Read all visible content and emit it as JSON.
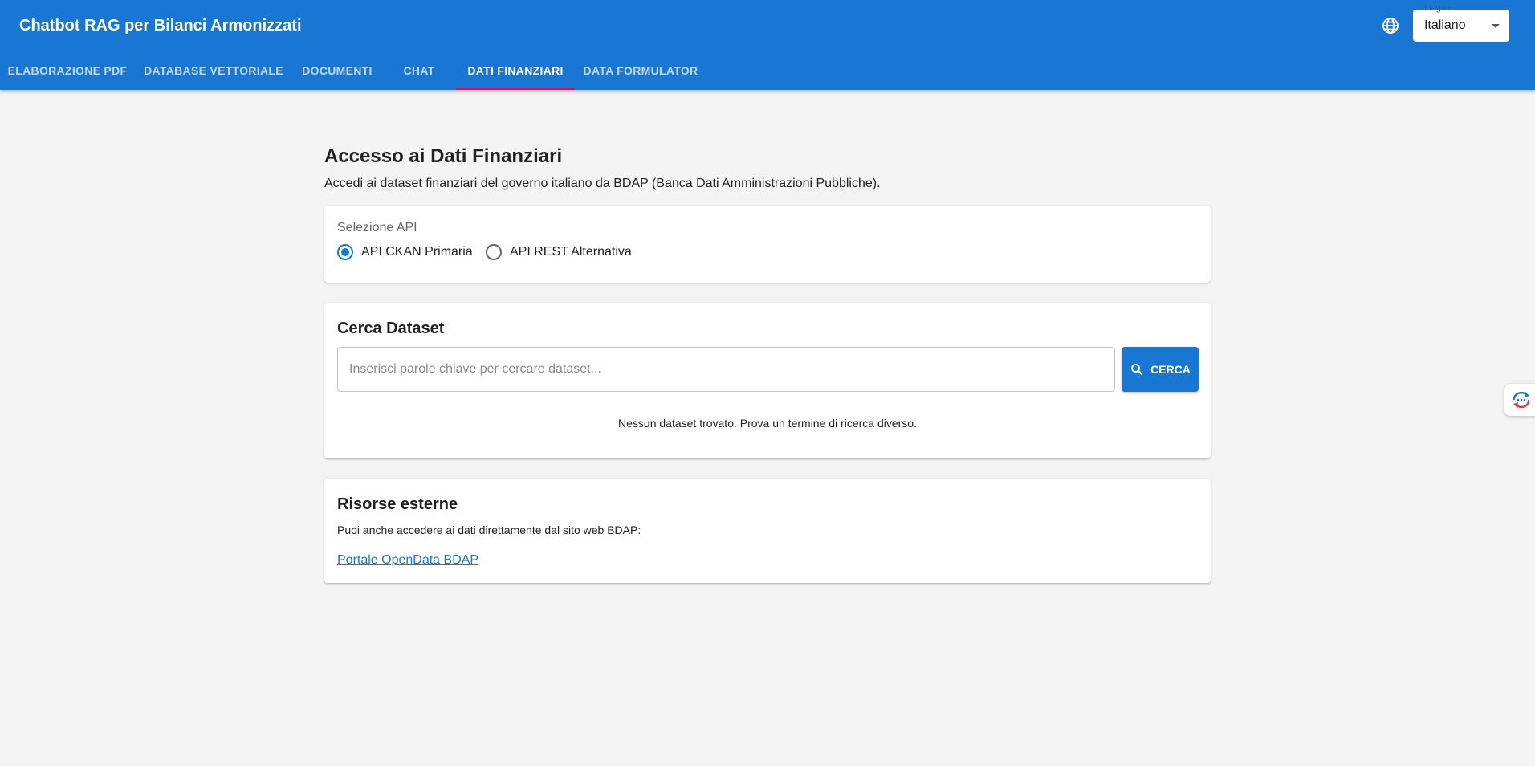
{
  "header": {
    "title": "Chatbot RAG per Bilanci Armonizzati",
    "language": {
      "label": "Lingua",
      "value": "Italiano",
      "icon": "globe-icon"
    },
    "tabs": [
      {
        "label": "ELABORAZIONE PDF",
        "active": false
      },
      {
        "label": "DATABASE VETTORIALE",
        "active": false
      },
      {
        "label": "DOCUMENTI",
        "active": false
      },
      {
        "label": "CHAT",
        "active": false
      },
      {
        "label": "DATI FINANZIARI",
        "active": true
      },
      {
        "label": "DATA FORMULATOR",
        "active": false
      }
    ]
  },
  "main": {
    "title": "Accesso ai Dati Finanziari",
    "subtitle": "Accedi ai dataset finanziari del governo italiano da BDAP (Banca Dati Amministrazioni Pubbliche).",
    "api_selection": {
      "label": "Selezione API",
      "options": [
        {
          "label": "API CKAN Primaria",
          "selected": true
        },
        {
          "label": "API REST Alternativa",
          "selected": false
        }
      ]
    },
    "search": {
      "heading": "Cerca Dataset",
      "placeholder": "Inserisci parole chiave per cercare dataset...",
      "value": "",
      "button_label": "CERCA",
      "empty_message": "Nessun dataset trovato. Prova un termine di ricerca diverso."
    },
    "external": {
      "heading": "Risorse esterne",
      "text": "Puoi anche accedere ai dati direttamente dal sito web BDAP:",
      "link_label": "Portale OpenData BDAP"
    }
  },
  "colors": {
    "primary": "#1976d2",
    "tab_indicator": "#f50057",
    "background": "#f4f4f4"
  }
}
